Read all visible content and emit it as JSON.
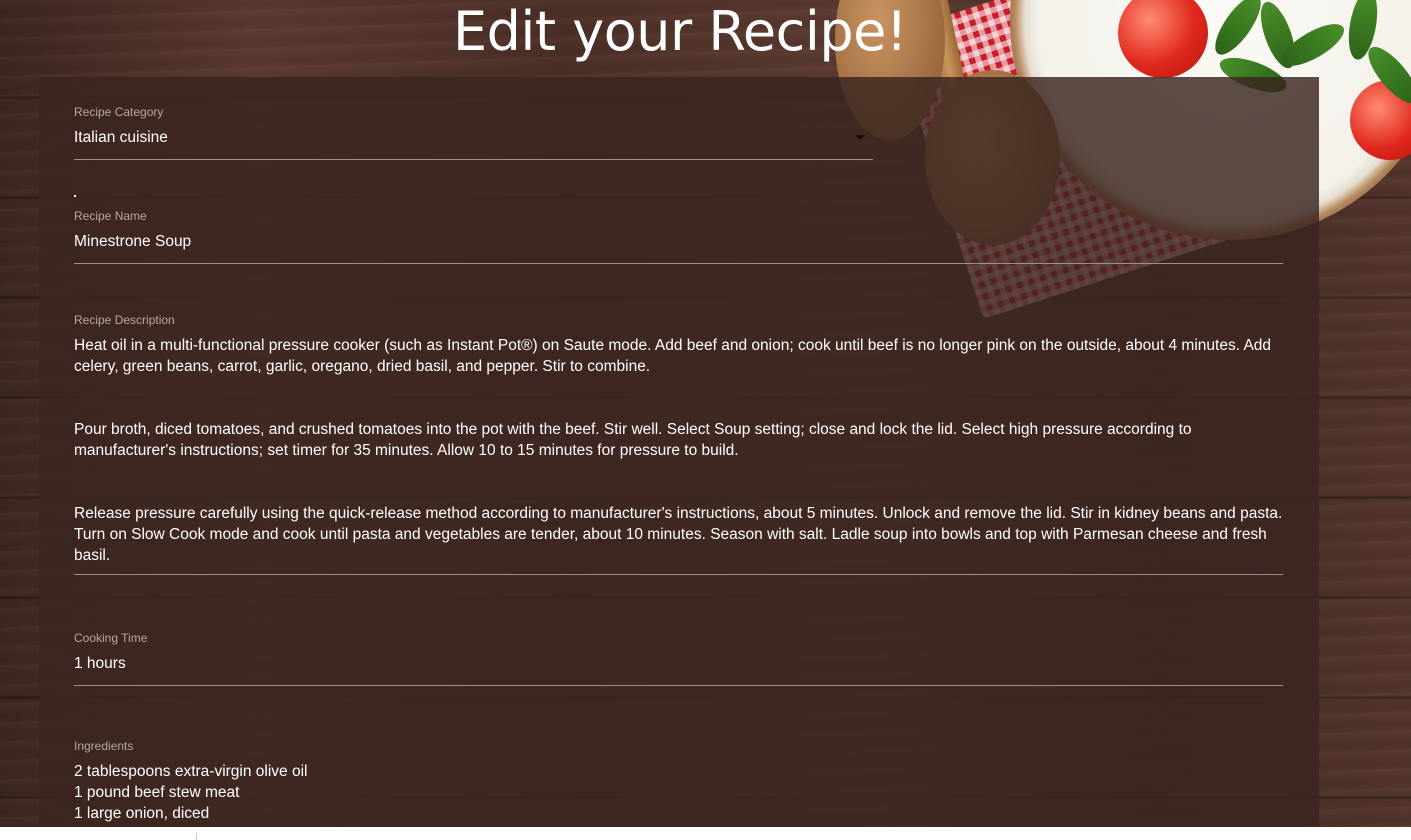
{
  "page": {
    "title": "Edit your Recipe!"
  },
  "form": {
    "category": {
      "label": "Recipe Category",
      "value": "Italian cuisine"
    },
    "name": {
      "label": "Recipe Name",
      "value": "Minestrone Soup"
    },
    "description": {
      "label": "Recipe Description",
      "paragraphs": [
        "Heat oil in a multi-functional pressure cooker (such as Instant Pot®) on Saute mode. Add beef and onion; cook until beef is no longer pink on the outside, about 4 minutes. Add celery, green beans, carrot, garlic, oregano, dried basil, and pepper. Stir to combine.",
        "Pour broth, diced tomatoes, and crushed tomatoes into the pot with the beef. Stir well. Select Soup setting; close and lock the lid. Select high pressure according to manufacturer's instructions; set timer for 35 minutes. Allow 10 to 15 minutes for pressure to build.",
        "Release pressure carefully using the quick-release method according to manufacturer's instructions, about 5 minutes. Unlock and remove the lid. Stir in kidney beans and pasta. Turn on Slow Cook mode and cook until pasta and vegetables are tender, about 10 minutes. Season with salt. Ladle soup into bowls and top with Parmesan cheese and fresh basil."
      ]
    },
    "cooking_time": {
      "label": "Cooking Time",
      "value": "1 hours"
    },
    "ingredients": {
      "label": "Ingredients",
      "lines": [
        "2 tablespoons extra-virgin olive oil",
        "1 pound beef stew meat",
        "1 large onion, diced"
      ]
    }
  },
  "icons": {
    "select_arrow": "chevron-down-icon"
  },
  "colors": {
    "panel": "#3a2520",
    "label": "#b3a8a3",
    "text": "#ffffff",
    "underline": "#9b908b"
  }
}
